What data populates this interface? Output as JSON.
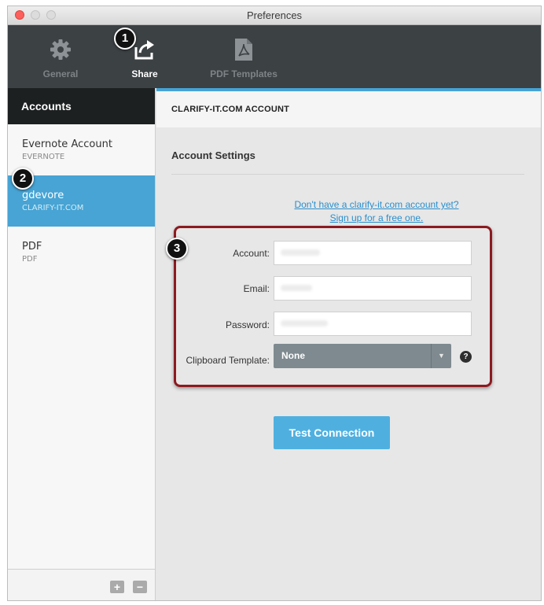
{
  "window": {
    "title": "Preferences"
  },
  "toolbar": {
    "items": [
      {
        "label": "General",
        "icon": "gear-icon",
        "active": false
      },
      {
        "label": "Share",
        "icon": "share-icon",
        "active": true
      },
      {
        "label": "PDF Templates",
        "icon": "pdf-icon",
        "active": false
      }
    ]
  },
  "badges": [
    "1",
    "2",
    "3"
  ],
  "sidebar": {
    "header": "Accounts",
    "accounts": [
      {
        "name": "Evernote Account",
        "type": "EVERNOTE"
      },
      {
        "name": "gdevore",
        "type": "CLARIFY-IT.COM",
        "selected": true
      },
      {
        "name": "PDF",
        "type": "PDF"
      }
    ],
    "add_label": "+",
    "remove_label": "−"
  },
  "main": {
    "header": "CLARIFY-IT.COM ACCOUNT",
    "section_title": "Account Settings",
    "signup_line1": "Don't have a clarify-it.com account yet?",
    "signup_line2": "Sign up for a free one.",
    "fields": {
      "account_label": "Account:",
      "email_label": "Email:",
      "password_label": "Password:",
      "template_label": "Clipboard Template:",
      "template_value": "None"
    },
    "help_label": "?",
    "test_button": "Test Connection"
  },
  "colors": {
    "accent": "#47a4d4",
    "toolbar_bg": "#3c4144",
    "highlight_box": "#8b1a1f"
  }
}
